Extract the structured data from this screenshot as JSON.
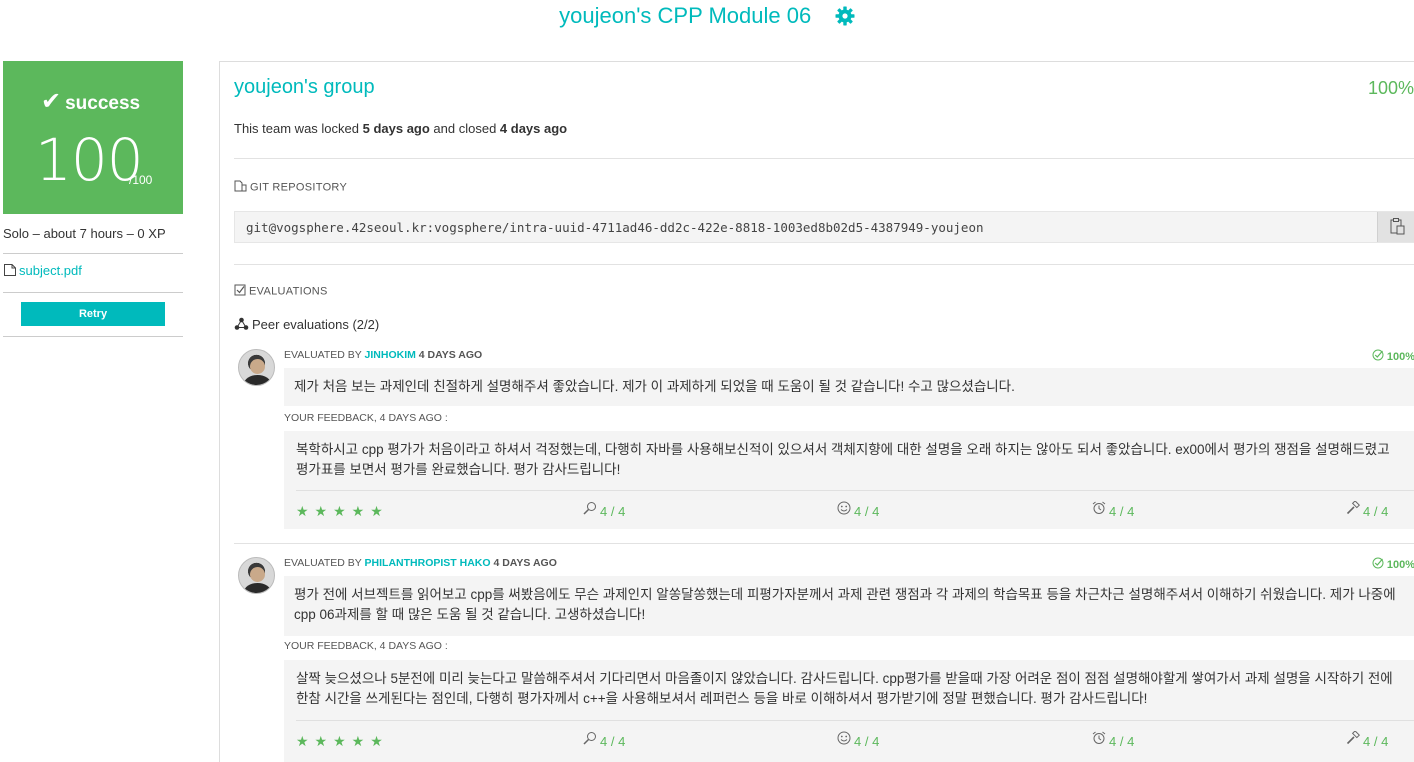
{
  "header": {
    "title": "youjeon's CPP Module 06"
  },
  "sidebar": {
    "status": "success",
    "mark": "100",
    "max": "/100",
    "meta": "Solo – about 7 hours – 0 XP",
    "subject_link": "subject.pdf",
    "retry_label": "Retry"
  },
  "team": {
    "name": "youjeon's group",
    "percentage": "100%",
    "lock_prefix": "This team was locked ",
    "locked_ago": "5 days ago",
    "lock_mid": " and closed ",
    "closed_ago": "4 days ago"
  },
  "git": {
    "label": "GIT REPOSITORY",
    "url": "git@vogsphere.42seoul.kr:vogsphere/intra-uuid-4711ad46-dd2c-422e-8818-1003ed8b02d5-4387949-youjeon"
  },
  "evaluations": {
    "label": "EVALUATIONS",
    "peer_title": "Peer evaluations (2/2)",
    "items": [
      {
        "by_prefix": "EVALUATED BY ",
        "login": "JINHOKIM",
        "when": " 4 DAYS AGO",
        "pct": "100%",
        "comment": "제가 처음 보는 과제인데 친절하게 설명해주셔 좋았습니다. 제가 이 과제하게 되었을 때 도움이 될 것 같습니다! 수고 많으셨습니다.",
        "feedback_label": "YOUR FEEDBACK, 4 DAYS AGO :",
        "feedback": "복학하시고 cpp 평가가 처음이라고 하셔서 걱정했는데, 다행히 자바를 사용해보신적이 있으셔서 객체지향에 대한 설명을 오래 하지는 않아도 되서 좋았습니다. ex00에서 평가의 쟁점을 설명해드렸고 평가표를 보면서 평가를 완료했습니다. 평가 감사드립니다!",
        "stars": "★★★★★",
        "ratings": [
          "4 / 4",
          "4 / 4",
          "4 / 4",
          "4 / 4"
        ]
      },
      {
        "by_prefix": "EVALUATED BY ",
        "login": "PHILANTHROPIST HAKO",
        "when": " 4 DAYS AGO",
        "pct": "100%",
        "comment": "평가 전에 서브젝트를 읽어보고 cpp를 써봤음에도 무슨 과제인지 알쏭달쏭했는데 피평가자분께서 과제 관련 쟁점과 각 과제의 학습목표 등을 차근차근 설명해주셔서 이해하기 쉬웠습니다. 제가 나중에 cpp 06과제를 할 때 많은 도움 될 것 같습니다. 고생하셨습니다!",
        "feedback_label": "YOUR FEEDBACK, 4 DAYS AGO :",
        "feedback": "살짝 늦으셨으나 5분전에 미리 늦는다고 말씀해주셔서 기다리면서 마음졸이지 않았습니다. 감사드립니다. cpp평가를 받을때 가장 어려운 점이 점점 설명해야할게 쌓여가서 과제 설명을 시작하기 전에 한참 시간을 쓰게된다는 점인데, 다행히 평가자께서 c++을 사용해보셔서 레퍼런스 등을 바로 이해하셔서 평가받기에 정말 편했습니다. 평가 감사드립니다!",
        "stars": "★★★★★",
        "ratings": [
          "4 / 4",
          "4 / 4",
          "4 / 4",
          "4 / 4"
        ]
      }
    ]
  }
}
